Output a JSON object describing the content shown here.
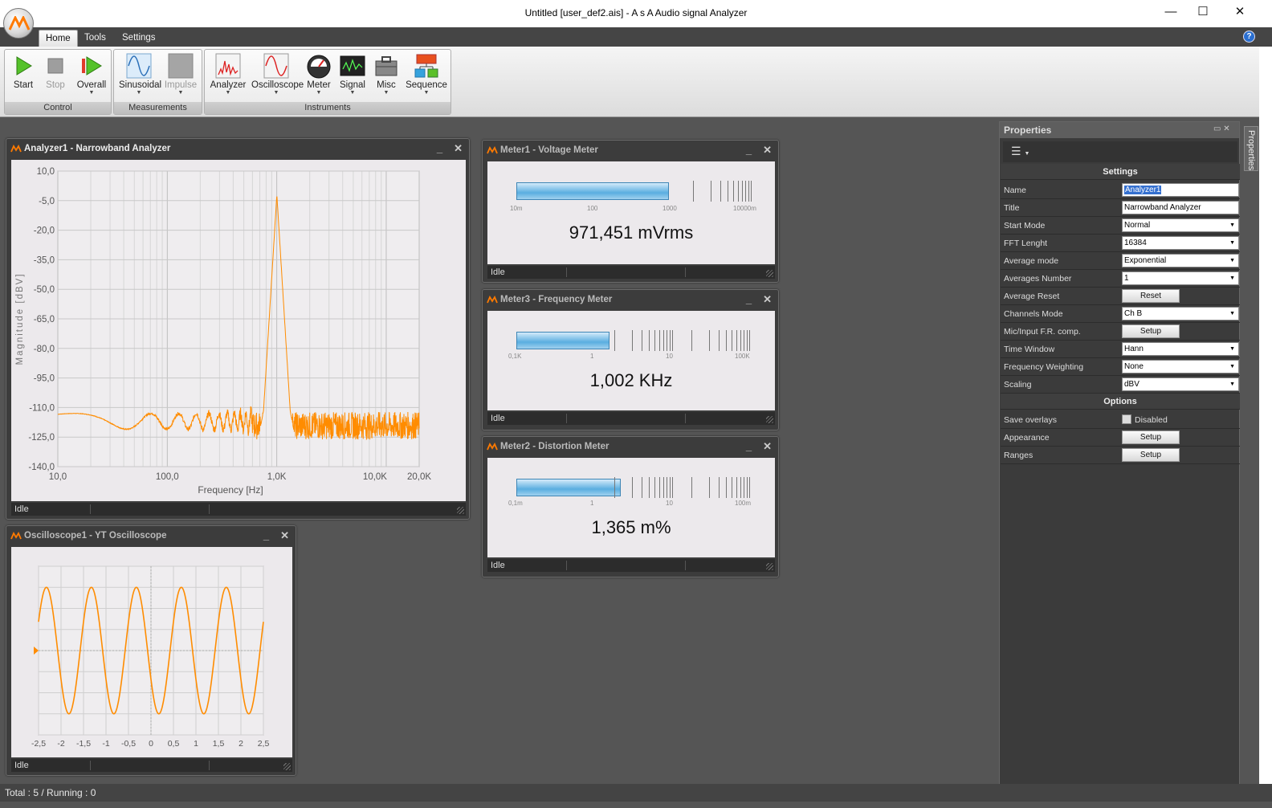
{
  "window": {
    "title": "Untitled [user_def2.ais] - A s A  Audio signal Analyzer",
    "min": "—",
    "max": "☐",
    "close": "✕"
  },
  "tabs": [
    {
      "label": "Home"
    },
    {
      "label": "Tools"
    },
    {
      "label": "Settings"
    }
  ],
  "ribbon": {
    "groups": {
      "control": "Control",
      "measurements": "Measurements",
      "instruments": "Instruments"
    },
    "buttons": {
      "start": "Start",
      "stop": "Stop",
      "overall": "Overall",
      "sinusoidal": "Sinusoidal",
      "impulse": "Impulse",
      "analyzer": "Analyzer",
      "oscilloscope": "Oscilloscope",
      "meter": "Meter",
      "signal": "Signal",
      "misc": "Misc",
      "sequence": "Sequence"
    }
  },
  "analyzer": {
    "title": "Analyzer1 - Narrowband Analyzer",
    "status": "Idle",
    "chart_data": {
      "type": "line",
      "xlabel": "Frequency [Hz]",
      "ylabel": "Magnitude [dBV]",
      "xscale": "log",
      "xlim": [
        10,
        20000
      ],
      "ylim": [
        -140,
        10
      ],
      "yticks": [
        "10,0",
        "-5,0",
        "-20,0",
        "-35,0",
        "-50,0",
        "-65,0",
        "-80,0",
        "-95,0",
        "-110,0",
        "-125,0",
        "-140,0"
      ],
      "xticks": [
        "10,0",
        "100,0",
        "1,0K",
        "10,0K",
        "20,0K"
      ],
      "grid": true,
      "color": "#ff8c00",
      "series": [
        {
          "peak_x": 1002,
          "peak_y": -2,
          "noise_floor_low": -118,
          "noise_floor_high": -122
        }
      ]
    }
  },
  "oscilloscope": {
    "title": "Oscilloscope1 - YT Oscilloscope",
    "status": "Idle",
    "chart_data": {
      "type": "line",
      "xlim": [
        -2.5,
        2.5
      ],
      "xticks": [
        "-2,5",
        "-2",
        "-1,5",
        "-1",
        "-0,5",
        "0",
        "0,5",
        "1",
        "1,5",
        "2",
        "2,5"
      ],
      "grid": true,
      "color": "#ff8c00",
      "series": [
        {
          "periods": 5,
          "amplitude": 0.75
        }
      ]
    }
  },
  "meters": [
    {
      "title": "Meter1 - Voltage Meter",
      "value": "971,451 mVrms",
      "status": "Idle",
      "ticks": [
        "10m",
        "100",
        "1000",
        "10000m"
      ],
      "fill": 0.54
    },
    {
      "title": "Meter3 - Frequency Meter",
      "value": "1,002 KHz",
      "status": "Idle",
      "ticks": [
        "0,1K",
        "1",
        "10",
        "100K"
      ],
      "fill": 0.33
    },
    {
      "title": "Meter2 - Distortion Meter",
      "value": "1,365 m%",
      "status": "Idle",
      "ticks": [
        "0,1m",
        "1",
        "10",
        "100m"
      ],
      "fill": 0.37
    }
  ],
  "properties": {
    "title": "Properties",
    "side_tab": "Properties",
    "settings_label": "Settings",
    "options_label": "Options",
    "rows": [
      {
        "name": "Name",
        "value": "Analyzer1",
        "kind": "text-selected"
      },
      {
        "name": "Title",
        "value": "Narrowband Analyzer",
        "kind": "text"
      },
      {
        "name": "Start Mode",
        "value": "Normal",
        "kind": "select"
      },
      {
        "name": "FFT Lenght",
        "value": "16384",
        "kind": "select"
      },
      {
        "name": "Average mode",
        "value": "Exponential",
        "kind": "select"
      },
      {
        "name": "Averages Number",
        "value": "1",
        "kind": "select"
      },
      {
        "name": "Average Reset",
        "value": "Reset",
        "kind": "button"
      },
      {
        "name": "Channels Mode",
        "value": "Ch B",
        "kind": "select"
      },
      {
        "name": "Mic/Input F.R. comp.",
        "value": "Setup",
        "kind": "button"
      },
      {
        "name": "Time Window",
        "value": "Hann",
        "kind": "select"
      },
      {
        "name": "Frequency Weighting",
        "value": "None",
        "kind": "select"
      },
      {
        "name": "Scaling",
        "value": "dBV",
        "kind": "select"
      }
    ],
    "option_rows": [
      {
        "name": "Save overlays",
        "value": "Disabled",
        "kind": "checkbox"
      },
      {
        "name": "Appearance",
        "value": "Setup",
        "kind": "button"
      },
      {
        "name": "Ranges",
        "value": "Setup",
        "kind": "button"
      }
    ]
  },
  "statusbar": {
    "text": "Total : 5  /  Running : 0"
  },
  "colors": {
    "accent": "#ff8c00",
    "meter_bar": "#5aaee0",
    "panel_bg": "#3c3c3c"
  }
}
